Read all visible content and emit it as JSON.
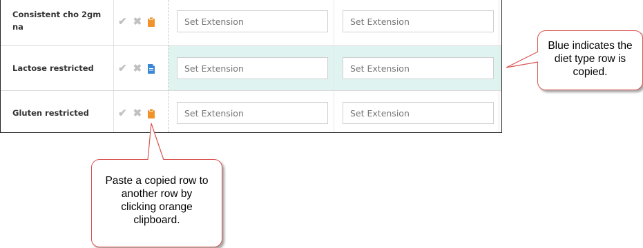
{
  "input_placeholder": "Set Extension",
  "rows": [
    {
      "label": "Consistent cho 2gm na",
      "clipboard_color": "#f0932b",
      "copied": false
    },
    {
      "label": "Lactose restricted",
      "clipboard_color": "#3b87d6",
      "copied": true
    },
    {
      "label": "Gluten restricted",
      "clipboard_color": "#f0932b",
      "copied": false
    }
  ],
  "icons": {
    "check": "check-icon",
    "remove": "x-icon",
    "paste": "clipboard-icon",
    "copied": "document-icon"
  },
  "callouts": {
    "right": "Blue indicates the diet type row is copied.",
    "bottom": "Paste a copied row to another row by clicking orange clipboard."
  },
  "colors": {
    "copied_row": "#dff3f1",
    "orange": "#f0932b",
    "blue": "#3b87d6",
    "callout_border": "#d9534f"
  }
}
